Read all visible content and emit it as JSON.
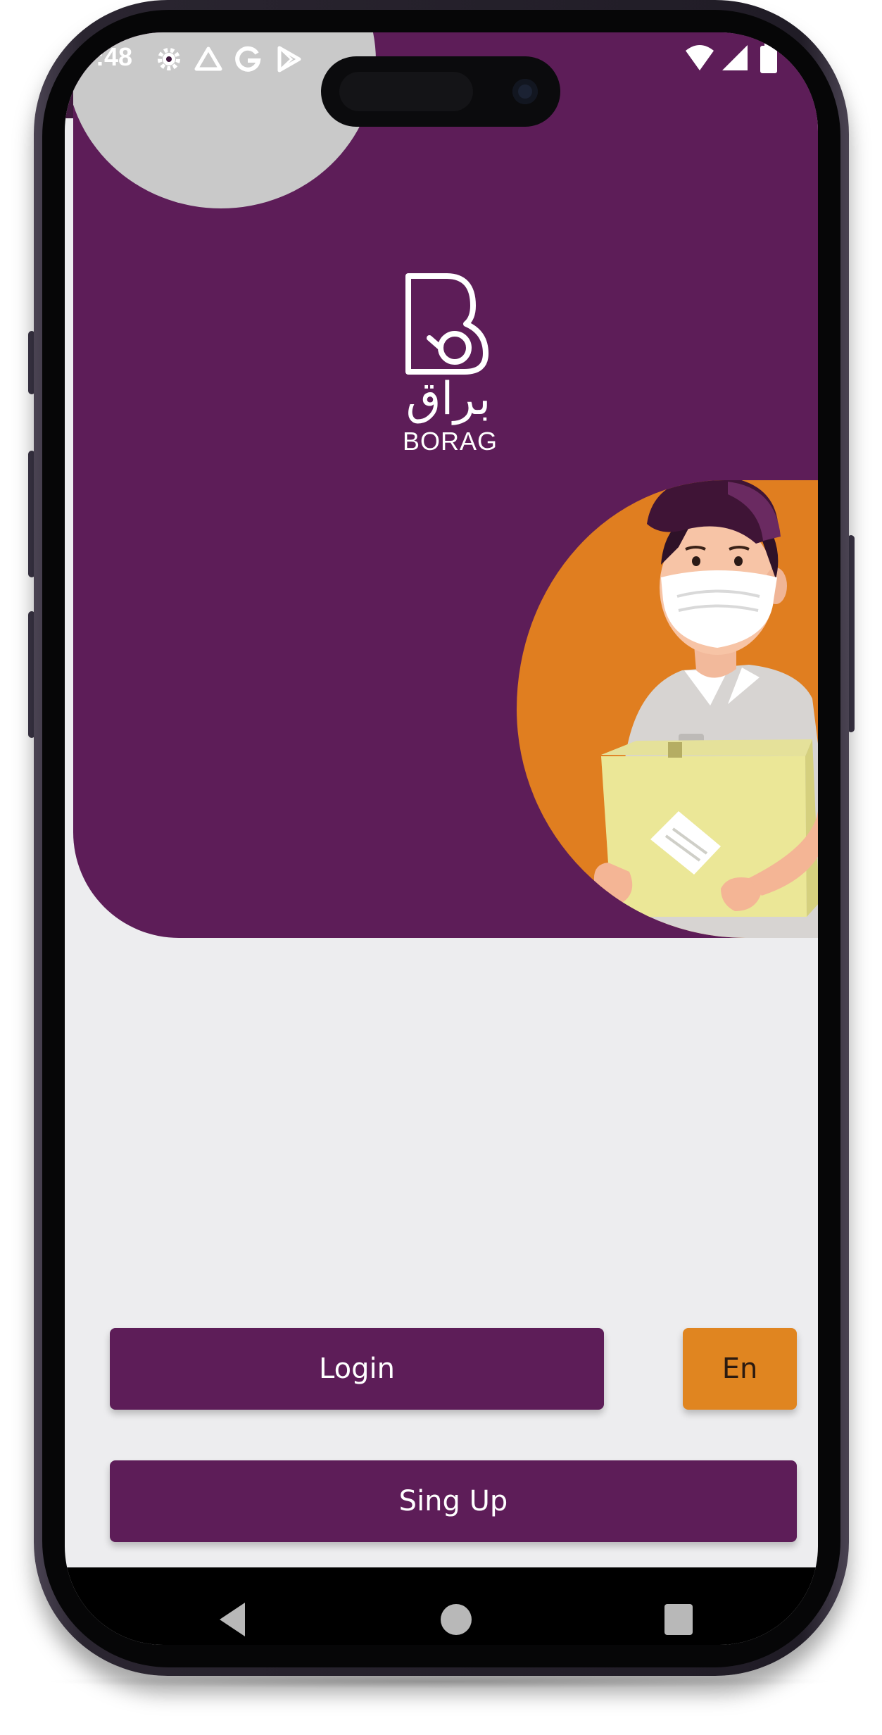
{
  "status_bar": {
    "time": ":48",
    "icons": [
      "settings-gear-icon",
      "drive-icon",
      "google-g-icon",
      "play-store-icon",
      "wifi-icon",
      "signal-icon",
      "battery-icon"
    ]
  },
  "brand": {
    "name_ar": "براق",
    "name_en": "BORAG",
    "logo_icon": "borag-b-logo-icon",
    "illustration": "delivery-man-with-box-illustration"
  },
  "actions": {
    "login_label": "Login",
    "signup_label": "Sing Up",
    "language_label": "En"
  },
  "navigation": {
    "back_icon": "back-triangle-icon",
    "home_icon": "home-circle-icon",
    "recents_icon": "recents-square-icon"
  },
  "colors": {
    "primary_purple": "#5d1d58",
    "accent_orange": "#e08520",
    "background": "#ededef",
    "status_bar": "#401a3e"
  }
}
